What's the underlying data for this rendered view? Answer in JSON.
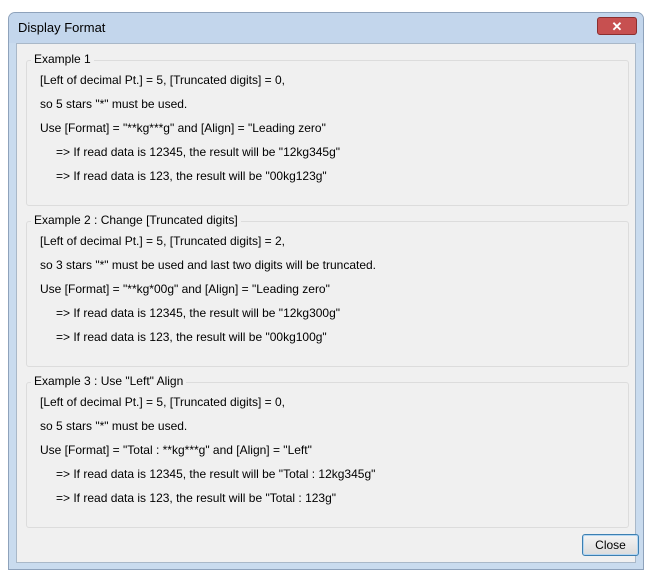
{
  "window": {
    "title": "Display Format",
    "close_glyph": "✕",
    "close_label": "Close"
  },
  "examples": [
    {
      "title": "Example 1",
      "lines": [
        "[Left of decimal Pt.] = 5, [Truncated digits] = 0,",
        "so 5 stars \"*\" must be used.",
        "Use [Format] = \"**kg***g\" and [Align] = \"Leading zero\"",
        "=> If read data is 12345, the result will be \"12kg345g\"",
        "=> If read data is 123, the result will be \"00kg123g\""
      ]
    },
    {
      "title": "Example 2 : Change [Truncated digits]",
      "lines": [
        "[Left of decimal Pt.] = 5, [Truncated digits] = 2,",
        "so 3 stars \"*\" must be used and last two digits will be truncated.",
        "Use [Format] = \"**kg*00g\" and [Align] = \"Leading zero\"",
        "=> If read data is 12345, the result will be \"12kg300g\"",
        "=> If read data is 123, the result will be \"00kg100g\""
      ]
    },
    {
      "title": "Example 3 : Use \"Left\" Align",
      "lines": [
        "[Left of decimal Pt.] = 5, [Truncated digits] = 0,",
        "so 5 stars \"*\" must be used.",
        "Use [Format] = \"Total : **kg***g\" and [Align] = \"Left\"",
        "=> If read data is 12345, the result will be \"Total : 12kg345g\"",
        "=> If read data is 123, the result will be \"Total : 123g\""
      ]
    }
  ]
}
